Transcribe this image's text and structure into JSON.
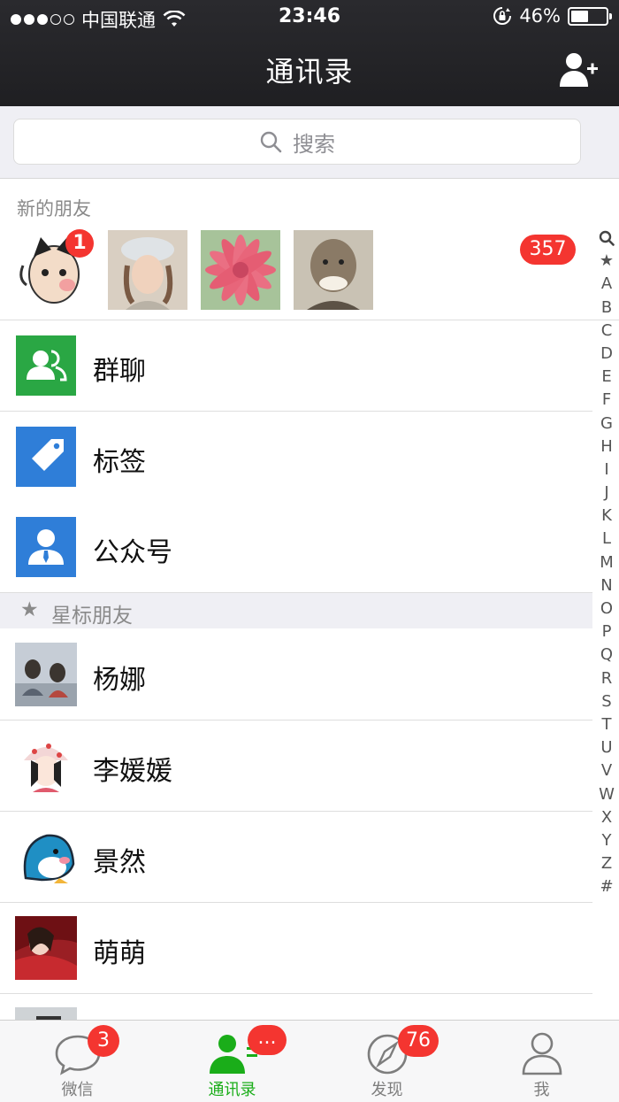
{
  "status": {
    "carrier": "中国联通",
    "time": "23:46",
    "battery": "46%",
    "battery_level": 0.46
  },
  "nav": {
    "title": "通讯录",
    "add_icon": "add-friend-icon"
  },
  "search": {
    "placeholder": "搜索"
  },
  "new_friends": {
    "label": "新的朋友",
    "count": "357",
    "first_badge": "1"
  },
  "rows": [
    {
      "label": "群聊",
      "icon": "group-chat-icon",
      "color": "#2aa744"
    },
    {
      "label": "标签",
      "icon": "tag-icon",
      "color": "#2f7ed8"
    },
    {
      "label": "公众号",
      "icon": "official-account-icon",
      "color": "#2f7ed8"
    }
  ],
  "starred": {
    "header": "星标朋友",
    "contacts": [
      {
        "name": "杨娜"
      },
      {
        "name": "李媛媛"
      },
      {
        "name": "景然"
      },
      {
        "name": "萌萌"
      }
    ]
  },
  "index": [
    "★",
    "A",
    "B",
    "C",
    "D",
    "E",
    "F",
    "G",
    "H",
    "I",
    "J",
    "K",
    "L",
    "M",
    "N",
    "O",
    "P",
    "Q",
    "R",
    "S",
    "T",
    "U",
    "V",
    "W",
    "X",
    "Y",
    "Z",
    "#"
  ],
  "tabs": [
    {
      "label": "微信",
      "icon": "chat-icon",
      "badge": "3"
    },
    {
      "label": "通讯录",
      "icon": "contacts-icon",
      "badge": "...",
      "active": true
    },
    {
      "label": "发现",
      "icon": "discover-icon",
      "badge": "76"
    },
    {
      "label": "我",
      "icon": "me-icon",
      "badge": ""
    }
  ],
  "colors": {
    "accent": "#1aad19",
    "badge": "#f43530",
    "nav_bg": "#222226"
  }
}
